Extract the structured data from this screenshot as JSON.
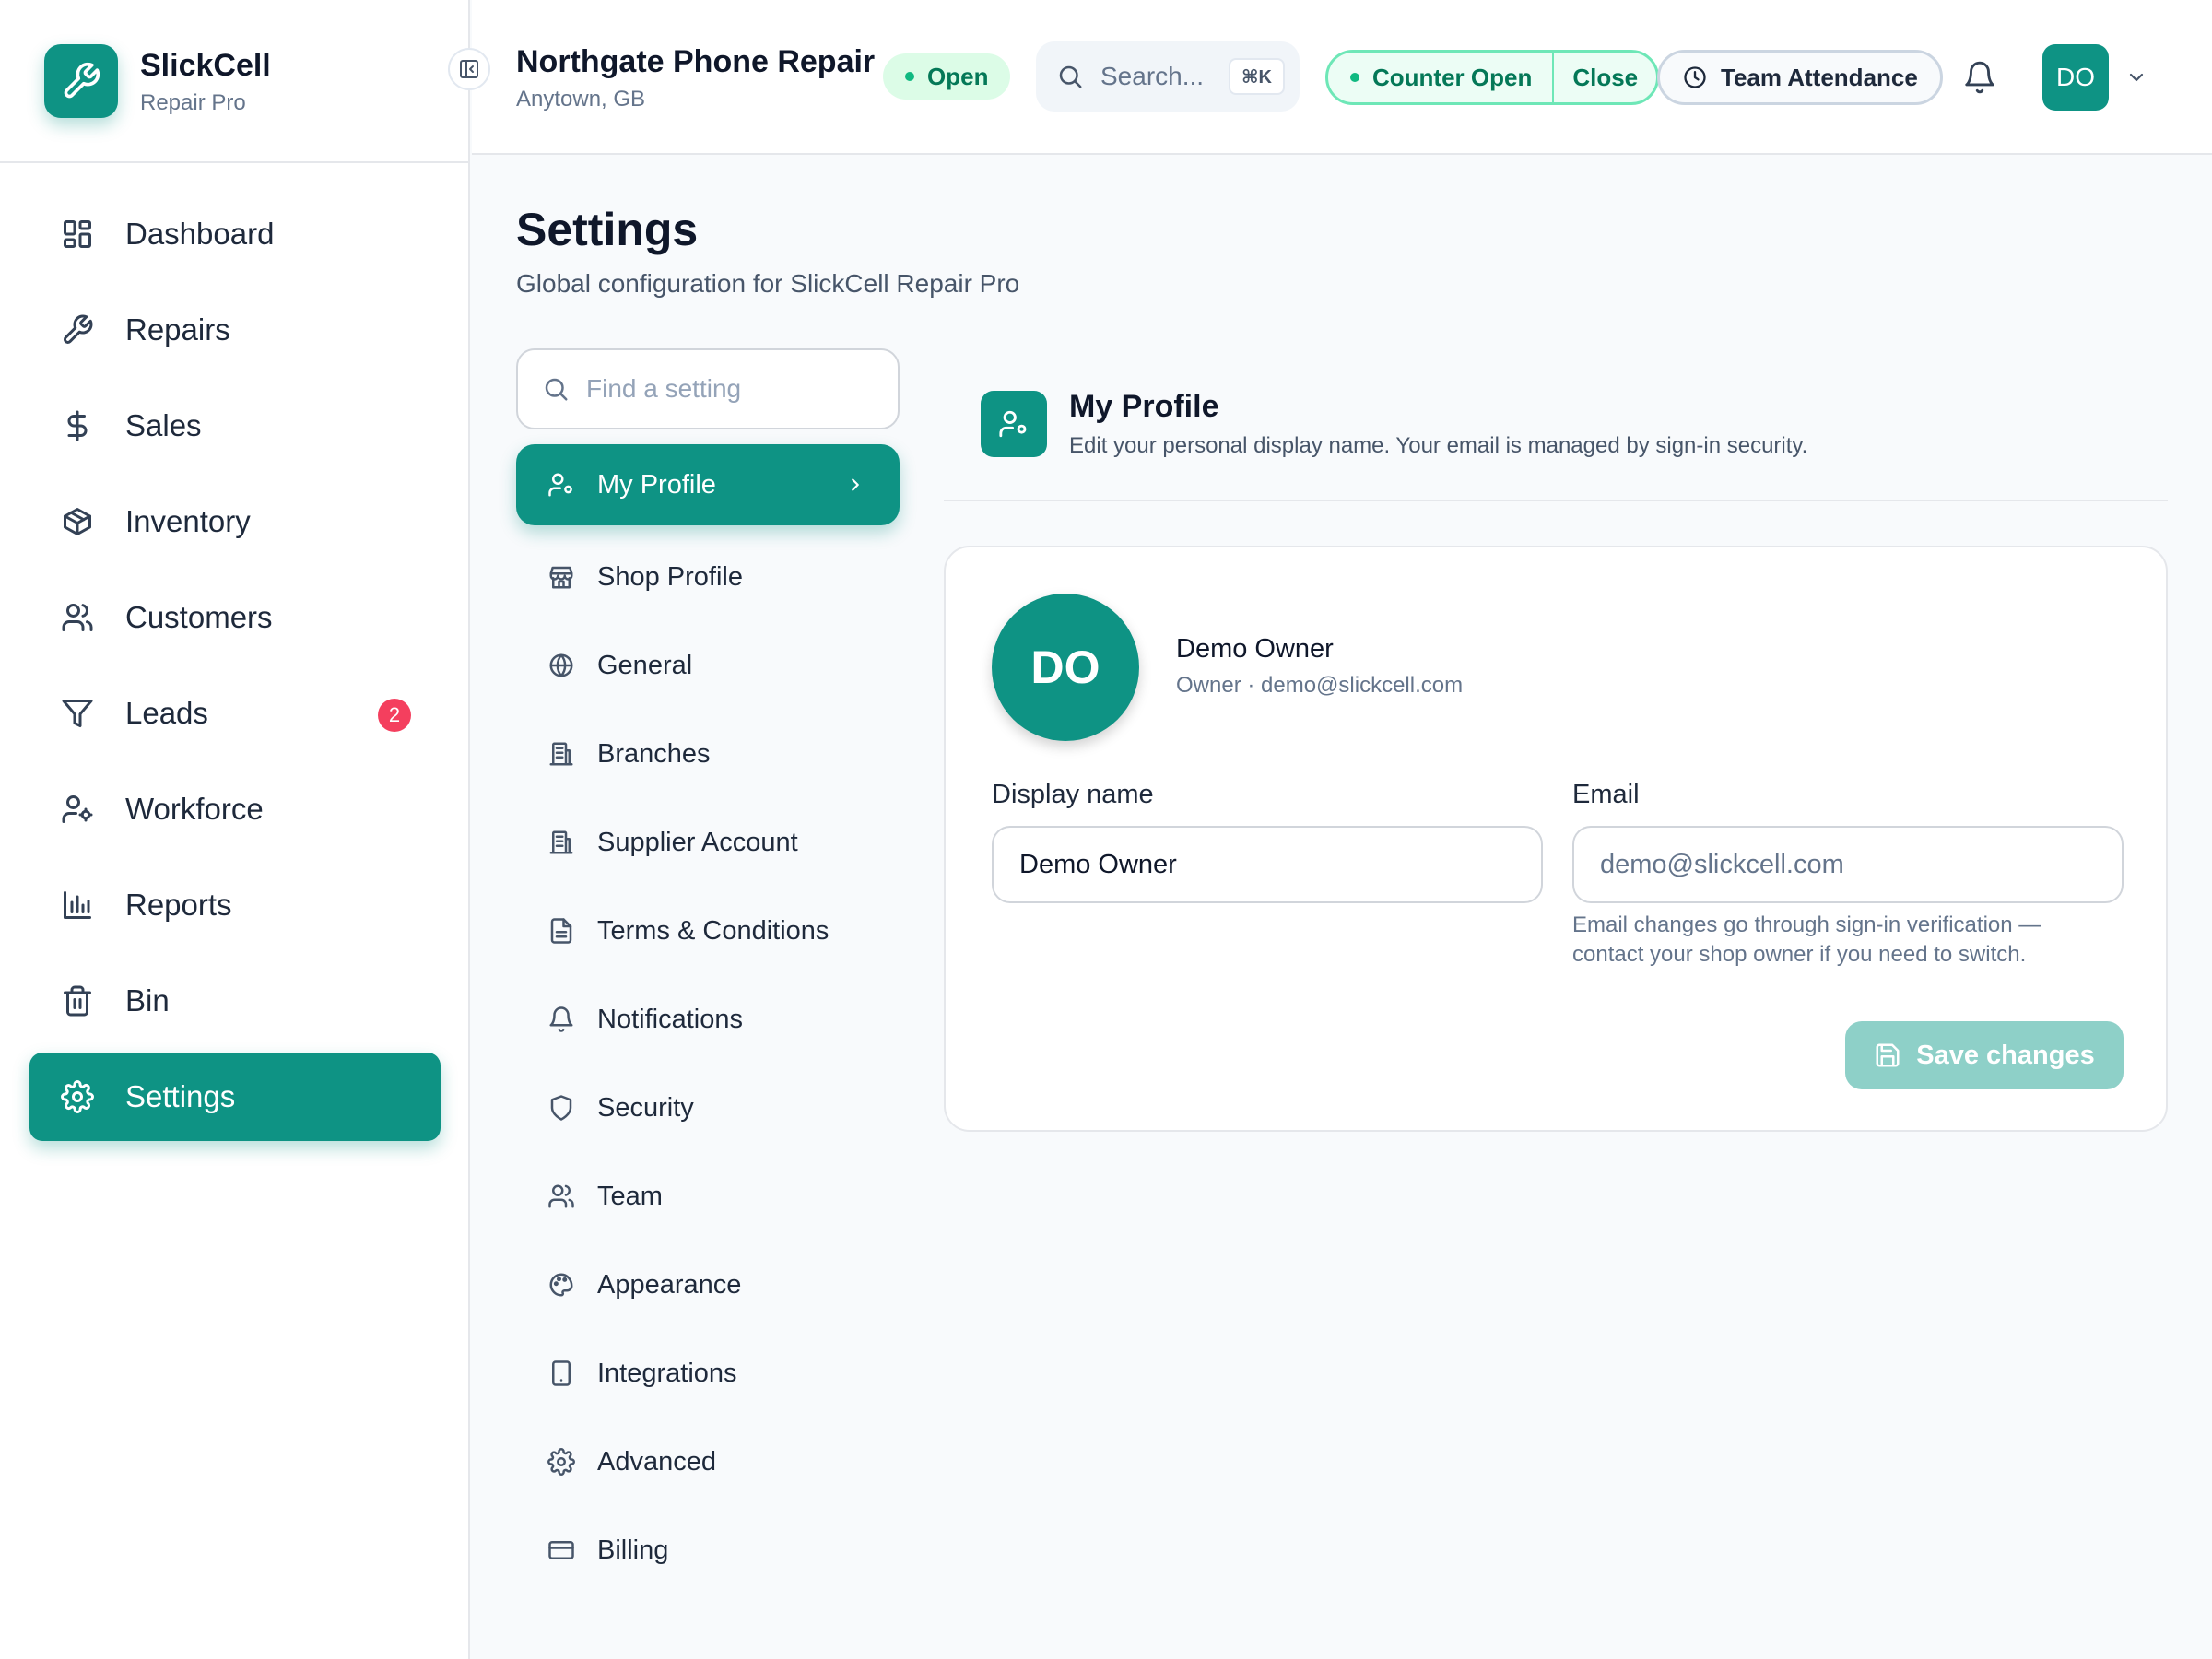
{
  "brand": {
    "name": "SlickCell",
    "subtitle": "Repair Pro"
  },
  "sidebar": {
    "items": [
      {
        "label": "Dashboard",
        "icon": "dashboard-icon"
      },
      {
        "label": "Repairs",
        "icon": "wrench-icon"
      },
      {
        "label": "Sales",
        "icon": "dollar-icon"
      },
      {
        "label": "Inventory",
        "icon": "box-icon"
      },
      {
        "label": "Customers",
        "icon": "users-icon"
      },
      {
        "label": "Leads",
        "icon": "filter-icon",
        "badge": "2"
      },
      {
        "label": "Workforce",
        "icon": "user-cog-icon"
      },
      {
        "label": "Reports",
        "icon": "bar-chart-icon"
      },
      {
        "label": "Bin",
        "icon": "trash-icon"
      },
      {
        "label": "Settings",
        "icon": "gear-icon",
        "active": true
      }
    ]
  },
  "header": {
    "shop_name": "Northgate Phone Repair",
    "location": "Anytown, GB",
    "status": "Open",
    "search_placeholder": "Search...",
    "search_shortcut": "⌘K",
    "counter_status": "Counter Open",
    "counter_close": "Close",
    "attendance": "Team Attendance",
    "user_initials": "DO"
  },
  "page": {
    "title": "Settings",
    "subtitle": "Global configuration for SlickCell Repair Pro",
    "find_placeholder": "Find a setting"
  },
  "settings_nav": [
    {
      "label": "My Profile",
      "icon": "user-cog-icon",
      "active": true
    },
    {
      "label": "Shop Profile",
      "icon": "store-icon"
    },
    {
      "label": "General",
      "icon": "globe-icon"
    },
    {
      "label": "Branches",
      "icon": "building-icon"
    },
    {
      "label": "Supplier Account",
      "icon": "building-icon"
    },
    {
      "label": "Terms & Conditions",
      "icon": "document-icon"
    },
    {
      "label": "Notifications",
      "icon": "bell-icon"
    },
    {
      "label": "Security",
      "icon": "shield-icon"
    },
    {
      "label": "Team",
      "icon": "users-icon"
    },
    {
      "label": "Appearance",
      "icon": "palette-icon"
    },
    {
      "label": "Integrations",
      "icon": "tablet-icon"
    },
    {
      "label": "Advanced",
      "icon": "gear-icon"
    },
    {
      "label": "Billing",
      "icon": "credit-card-icon"
    }
  ],
  "profile": {
    "section_title": "My Profile",
    "section_desc": "Edit your personal display name. Your email is managed by sign-in security.",
    "initials": "DO",
    "name": "Demo Owner",
    "meta": "Owner · demo@slickcell.com",
    "display_name_label": "Display name",
    "display_name_value": "Demo Owner",
    "email_label": "Email",
    "email_value": "demo@slickcell.com",
    "email_hint": "Email changes go through sign-in verification — contact your shop owner if you need to switch.",
    "save_label": "Save changes"
  },
  "colors": {
    "accent": "#0e9384",
    "accent_disabled": "#8ed0c8",
    "open_bg": "#dcfce7",
    "open_text": "#047857",
    "badge": "#f43f5e"
  }
}
